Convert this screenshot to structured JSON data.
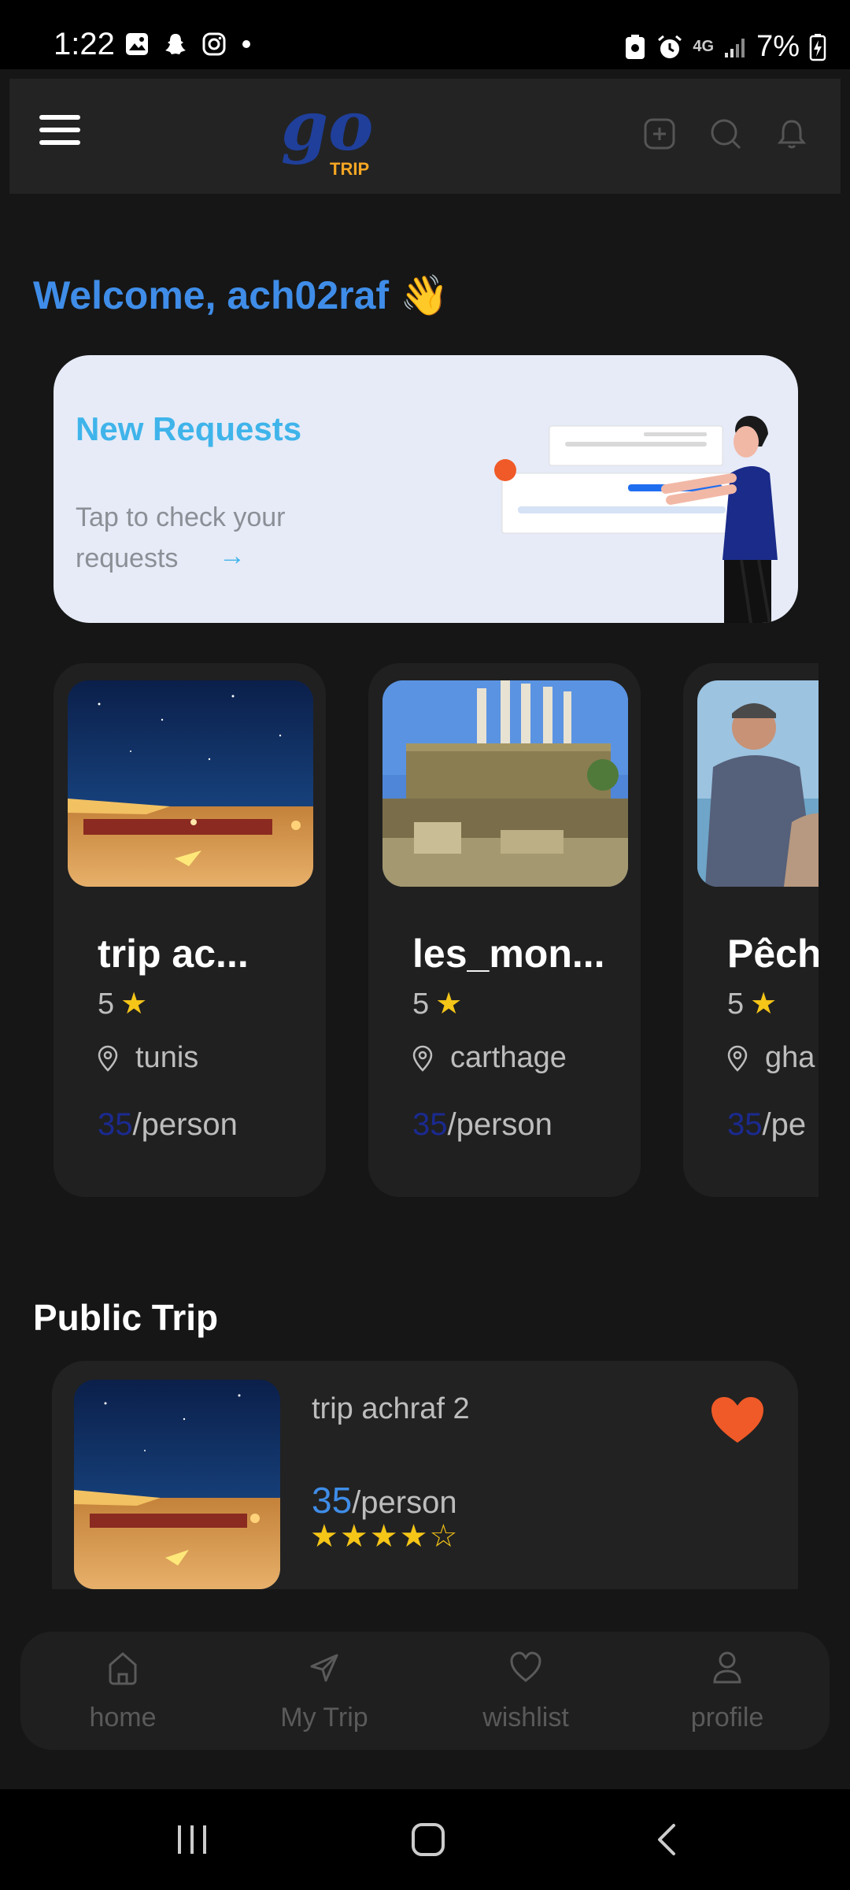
{
  "status_bar": {
    "time": "1:22",
    "battery": "7%",
    "network": "4G"
  },
  "header": {
    "logo_text_main": "go",
    "logo_text_sub": "TRIP"
  },
  "welcome": {
    "text": "Welcome, ach02raf",
    "emoji": "👋"
  },
  "requests_card": {
    "title": "New Requests",
    "subtitle": "Tap to check your requests",
    "arrow": "→"
  },
  "trips": [
    {
      "name": "trip ac...",
      "rating": "5",
      "location": "tunis",
      "price": "35",
      "unit": "/person"
    },
    {
      "name": "les_mon...",
      "rating": "5",
      "location": "carthage",
      "price": "35",
      "unit": "/person"
    },
    {
      "name": "Pêch",
      "rating": "5",
      "location": "gha",
      "price": "35",
      "unit": "/pe"
    }
  ],
  "public_section": {
    "title": "Public Trip"
  },
  "public_trip": {
    "name": "trip achraf 2",
    "price": "35",
    "unit": "/person",
    "stars": "★★★★☆",
    "rating_value": 4
  },
  "bottom_nav": {
    "items": [
      {
        "label": "home",
        "active": true
      },
      {
        "label": "My Trip",
        "active": false
      },
      {
        "label": "wishlist",
        "active": false
      },
      {
        "label": "profile",
        "active": false
      }
    ]
  },
  "colors": {
    "accent": "#3f8de8",
    "request_title": "#3fb4ea",
    "star": "#f5c518",
    "heart": "#f05a28",
    "price_dark": "#1b2a8f"
  }
}
